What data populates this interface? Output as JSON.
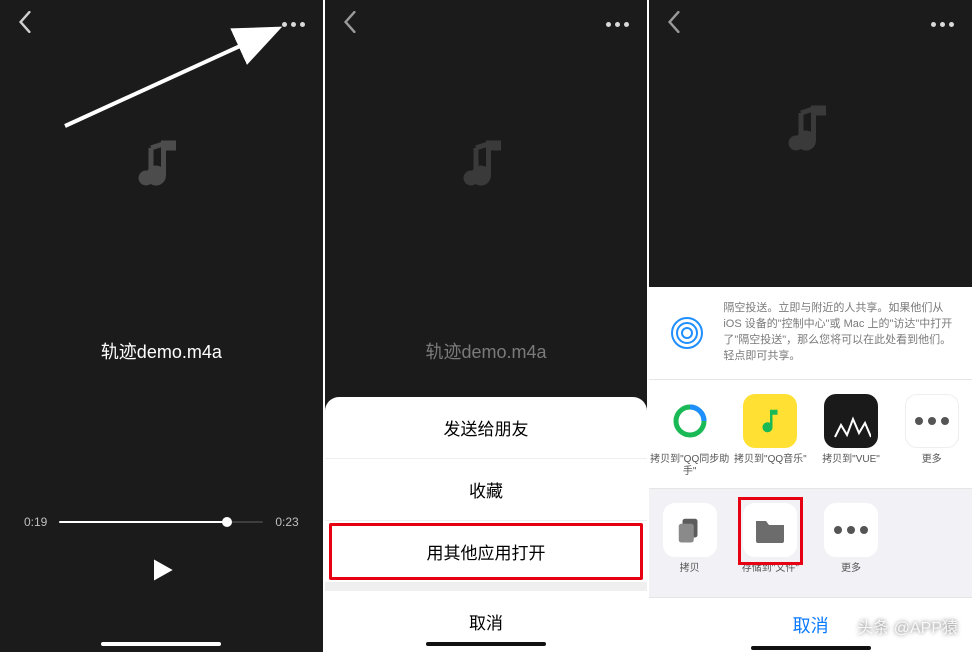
{
  "filename": "轨迹demo.m4a",
  "player": {
    "current": "0:19",
    "total": "0:23"
  },
  "sheet": {
    "send_friend": "发送给朋友",
    "favorite": "收藏",
    "open_other": "用其他应用打开",
    "cancel": "取消"
  },
  "airdrop_text": "隔空投送。立即与附近的人共享。如果他们从 iOS 设备的\"控制中心\"或 Mac 上的\"访达\"中打开了\"隔空投送\"，那么您将可以在此处看到他们。轻点即可共享。",
  "share_apps": [
    {
      "label": "拷贝到\"QQ同步助手\""
    },
    {
      "label": "拷贝到\"QQ音乐\""
    },
    {
      "label": "拷贝到\"VUE\""
    },
    {
      "label": "更多"
    }
  ],
  "share_actions": [
    {
      "label": "拷贝"
    },
    {
      "label": "存储到\"文件\""
    },
    {
      "label": "更多"
    }
  ],
  "share_cancel": "取消",
  "watermark": "头条 @APP猿"
}
